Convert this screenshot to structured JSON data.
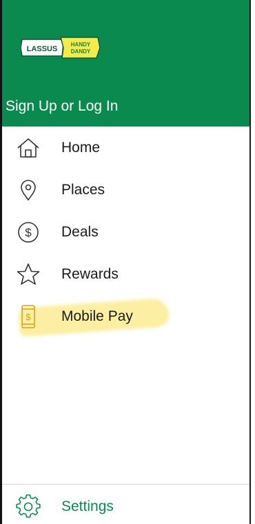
{
  "brand": {
    "logo_left": "LASSUS",
    "logo_right_line1": "HANDY",
    "logo_right_line2": "DANDY"
  },
  "header": {
    "signin_label": "Sign Up or Log In"
  },
  "menu": {
    "items": [
      {
        "label": "Home",
        "icon": "home-icon"
      },
      {
        "label": "Places",
        "icon": "map-pin-icon"
      },
      {
        "label": "Deals",
        "icon": "dollar-circle-icon"
      },
      {
        "label": "Rewards",
        "icon": "star-icon"
      },
      {
        "label": "Mobile Pay",
        "icon": "mobile-pay-icon"
      }
    ]
  },
  "footer": {
    "settings_label": "Settings",
    "settings_icon": "gear-icon"
  },
  "colors": {
    "brand_green": "#0b8a4f",
    "mobile_pay_icon": "#d6a21c",
    "highlight": "#fae15a"
  }
}
